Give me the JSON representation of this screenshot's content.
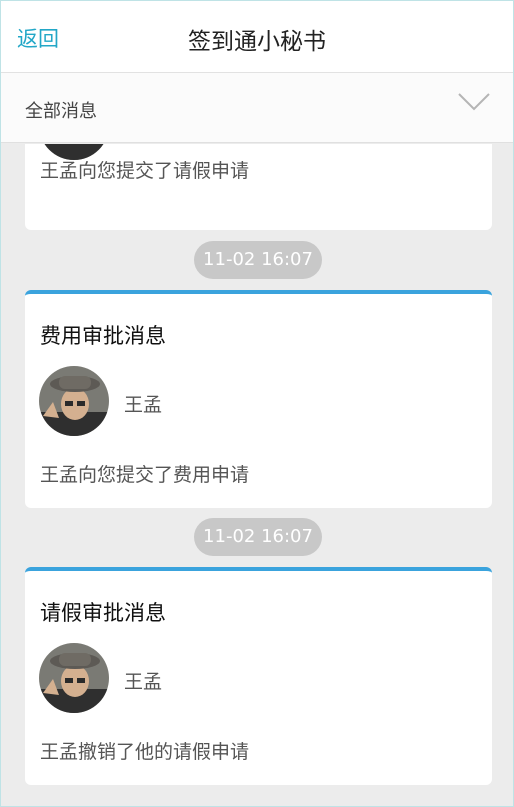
{
  "header": {
    "back_label": "返回",
    "title": "签到通小秘书"
  },
  "filter": {
    "label": "全部消息"
  },
  "messages": [
    {
      "title": "",
      "user": "",
      "description": "王孟向您提交了请假申请"
    },
    {
      "time": "11-02 16:07",
      "title": "费用审批消息",
      "user": "王孟",
      "description": "王孟向您提交了费用申请"
    },
    {
      "time": "11-02 16:07",
      "title": "请假审批消息",
      "user": "王孟",
      "description": "王孟撤销了他的请假申请"
    }
  ],
  "colors": {
    "accent": "#22a7c7",
    "card_top_border": "#3aa3dd",
    "time_badge": "#c8c8c8",
    "background": "#ececec"
  },
  "icons": {
    "filter_toggle": "chevron-down-icon",
    "avatar": "user-avatar-photo"
  }
}
